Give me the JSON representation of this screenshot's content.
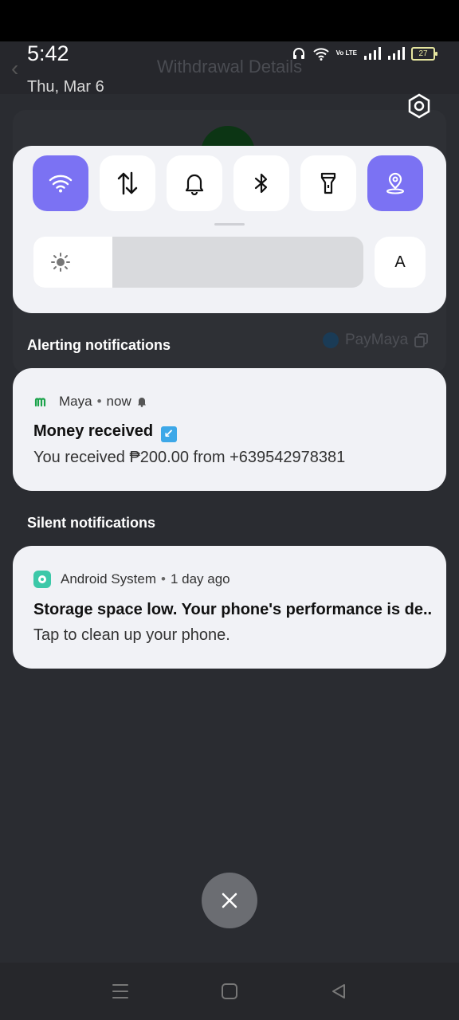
{
  "status_bar": {
    "time": "5:42",
    "date": "Thu, Mar 6",
    "battery": "27",
    "network": "Vo LTE"
  },
  "background_app": {
    "title": "Withdrawal Details",
    "provider": "PayMaya"
  },
  "quick_settings": {
    "tiles": [
      {
        "name": "wifi",
        "icon": "wifi-icon",
        "active": true
      },
      {
        "name": "mobile-data",
        "icon": "data-arrows-icon",
        "active": false
      },
      {
        "name": "sound",
        "icon": "bell-icon",
        "active": false
      },
      {
        "name": "bluetooth",
        "icon": "bluetooth-icon",
        "active": false
      },
      {
        "name": "flashlight",
        "icon": "flashlight-icon",
        "active": false
      },
      {
        "name": "location",
        "icon": "location-icon",
        "active": true
      }
    ],
    "brightness_level": 0.24,
    "auto_brightness_label": "A",
    "active_color": "#7b72f3"
  },
  "sections": {
    "alerting": "Alerting notifications",
    "silent": "Silent notifications"
  },
  "notifications": [
    {
      "app": "Maya",
      "time": "now",
      "title": "Money received",
      "body": "You received ₱200.00 from +639542978381",
      "app_color": "#1aa34a"
    },
    {
      "app": "Android System",
      "time": "1 day ago",
      "title": "Storage space low. Your phone's performance is de..",
      "body": "Tap to clean up your phone.",
      "app_color": "#3cc8a8"
    }
  ],
  "separator": "•"
}
